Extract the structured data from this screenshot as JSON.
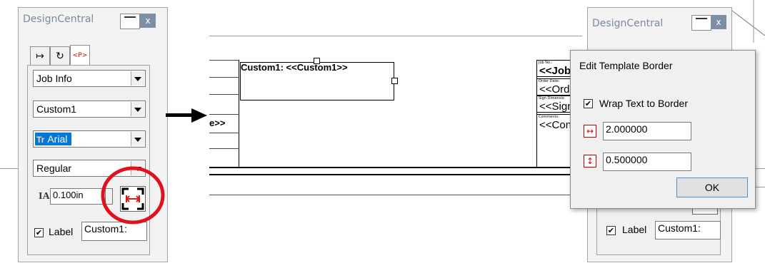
{
  "left_panel": {
    "title": "DesignCentral",
    "close_glyph": "x",
    "tabs": [
      "↦",
      "↻",
      "<P>"
    ],
    "category_select": "Job Info",
    "field_select": "Custom1",
    "font_select": "Arial",
    "font_icon_text": "Tr",
    "style_select": "Regular",
    "size_icon_text": "IA",
    "size_value": "0.100in",
    "label_checked": true,
    "label_text": "Label",
    "label_value": "Custom1:"
  },
  "canvas": {
    "field_text": "Custom1: <<Custom1>>",
    "partial_left_text": "e>>",
    "template_rows": [
      "<<Job",
      "<<Ord",
      "<<Sign",
      "<<Con"
    ],
    "template_small_labels": [
      "Job No.:",
      "Order Date:",
      "Sign Dimensio",
      "Comments:"
    ]
  },
  "right_panel": {
    "title": "DesignCentral",
    "close_glyph": "x",
    "label_checked": true,
    "label_text": "Label",
    "label_value": "Custom1:"
  },
  "dialog": {
    "title": "Edit Template Border",
    "wrap_checked": true,
    "wrap_label": "Wrap Text to Border",
    "width_value": "2.000000",
    "height_value": "0.500000",
    "ok_label": "OK"
  },
  "colors": {
    "highlight": "#0078d7",
    "annotation_circle": "#e0101c",
    "border_icon": "#d41c1c"
  }
}
